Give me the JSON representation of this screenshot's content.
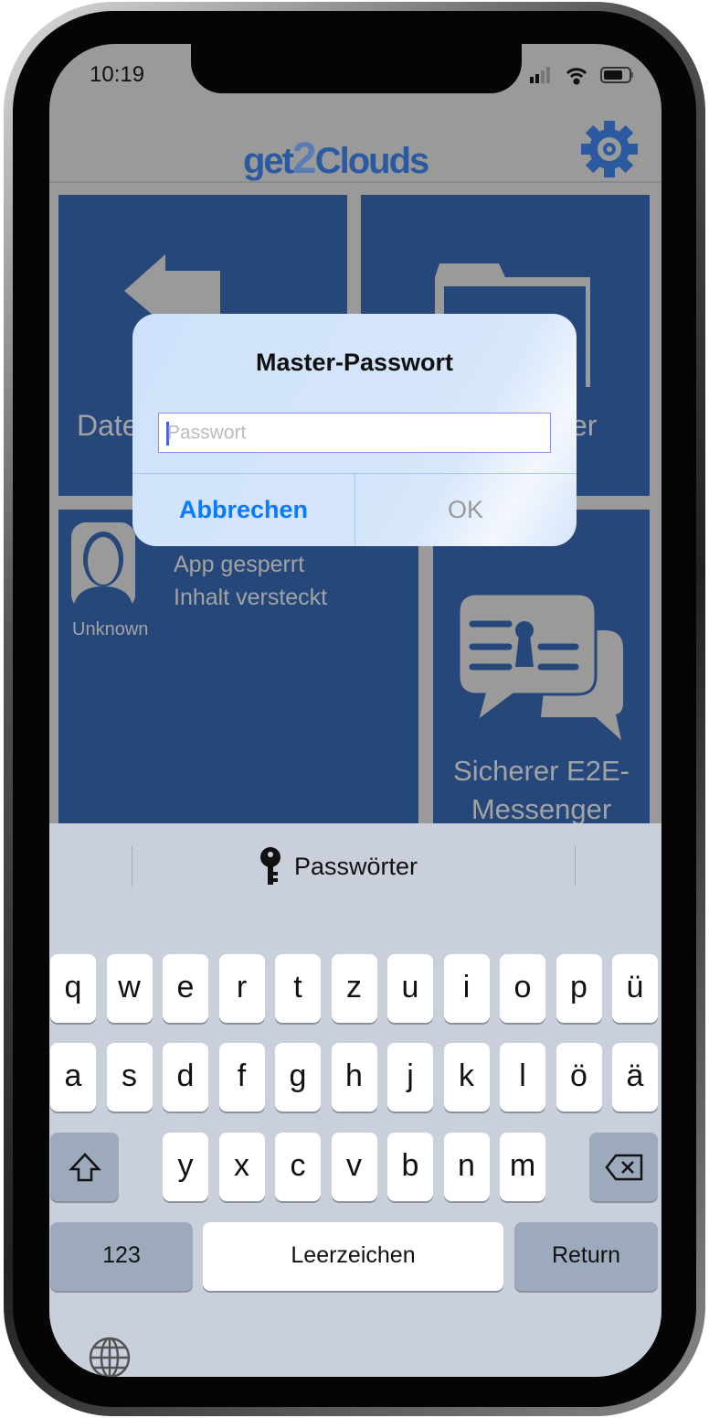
{
  "status_bar": {
    "time": "10:19"
  },
  "header": {
    "logo": "get2Clouds",
    "settings_icon": "gear-icon"
  },
  "tiles": [
    {
      "label": "Date",
      "icon": "arrows-icon"
    },
    {
      "label": "er",
      "icon": "folder-icon"
    },
    {
      "user_name": "Unknown",
      "line1": "App gesperrt",
      "line2": "Inhalt versteckt",
      "icon": "avatar-icon"
    },
    {
      "line1": "Sicherer E2E-",
      "line2": "Messenger",
      "icon": "chat-lock-icon"
    }
  ],
  "dialog": {
    "title": "Master-Passwort",
    "input_value": "",
    "input_placeholder": "Passwort",
    "cancel": "Abbrechen",
    "ok": "OK"
  },
  "keyboard": {
    "suggestion": "Passwörter",
    "row1": [
      "q",
      "w",
      "e",
      "r",
      "t",
      "z",
      "u",
      "i",
      "o",
      "p",
      "ü"
    ],
    "row2": [
      "a",
      "s",
      "d",
      "f",
      "g",
      "h",
      "j",
      "k",
      "l",
      "ö",
      "ä"
    ],
    "row3": [
      "y",
      "x",
      "c",
      "v",
      "b",
      "n",
      "m"
    ],
    "numbers": "123",
    "space": "Leerzeichen",
    "return": "Return"
  },
  "colors": {
    "tile": "#26477a",
    "accent": "#0a7aff",
    "logo": "#2c5aa0"
  }
}
